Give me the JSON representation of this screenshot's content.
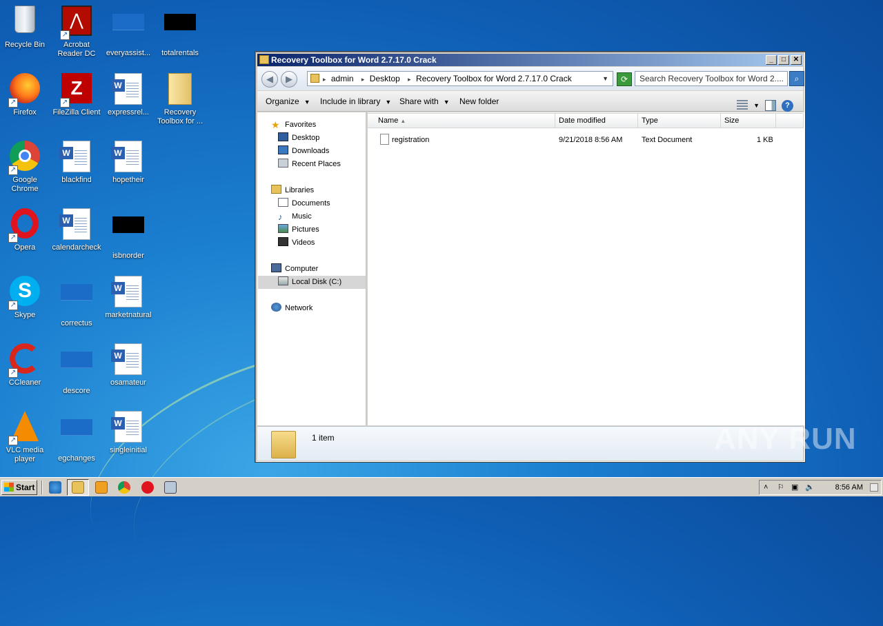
{
  "desktop": {
    "icons": [
      {
        "label": "Recycle Bin"
      },
      {
        "label": "Acrobat Reader DC"
      },
      {
        "label": "everyassist..."
      },
      {
        "label": "totalrentals"
      },
      {
        "label": "Firefox"
      },
      {
        "label": "FileZilla Client"
      },
      {
        "label": "expressrel..."
      },
      {
        "label": "Recovery Toolbox for ..."
      },
      {
        "label": "Google Chrome"
      },
      {
        "label": "blackfind"
      },
      {
        "label": "hopetheir"
      },
      {
        "label": "Opera"
      },
      {
        "label": "calendarcheck"
      },
      {
        "label": "isbnorder"
      },
      {
        "label": "Skype"
      },
      {
        "label": "correctus"
      },
      {
        "label": "marketnatural"
      },
      {
        "label": "CCleaner"
      },
      {
        "label": "descore"
      },
      {
        "label": "osamateur"
      },
      {
        "label": "VLC media player"
      },
      {
        "label": "egchanges"
      },
      {
        "label": "singleinitial"
      }
    ]
  },
  "window": {
    "title": "Recovery Toolbox for Word 2.7.17.0 Crack",
    "address": {
      "segments": [
        "admin",
        "Desktop",
        "Recovery Toolbox for Word 2.7.17.0 Crack"
      ]
    },
    "search": {
      "placeholder": "Search Recovery Toolbox for Word 2...."
    },
    "commands": {
      "organize": "Organize",
      "include_in_library": "Include in library",
      "share_with": "Share with",
      "new_folder": "New folder"
    },
    "nav": {
      "favorites": "Favorites",
      "desktop": "Desktop",
      "downloads": "Downloads",
      "recent_places": "Recent Places",
      "libraries": "Libraries",
      "documents": "Documents",
      "music": "Music",
      "pictures": "Pictures",
      "videos": "Videos",
      "computer": "Computer",
      "local_disk": "Local Disk (C:)",
      "network": "Network"
    },
    "columns": {
      "name": "Name",
      "date_modified": "Date modified",
      "type": "Type",
      "size": "Size"
    },
    "files": [
      {
        "name": "registration",
        "date_modified": "9/21/2018 8:56 AM",
        "type": "Text Document",
        "size": "1 KB"
      }
    ],
    "status": {
      "item_count": "1 item"
    }
  },
  "watermark": "ANY RUN",
  "taskbar": {
    "start_label": "Start",
    "clock": "8:56 AM"
  }
}
